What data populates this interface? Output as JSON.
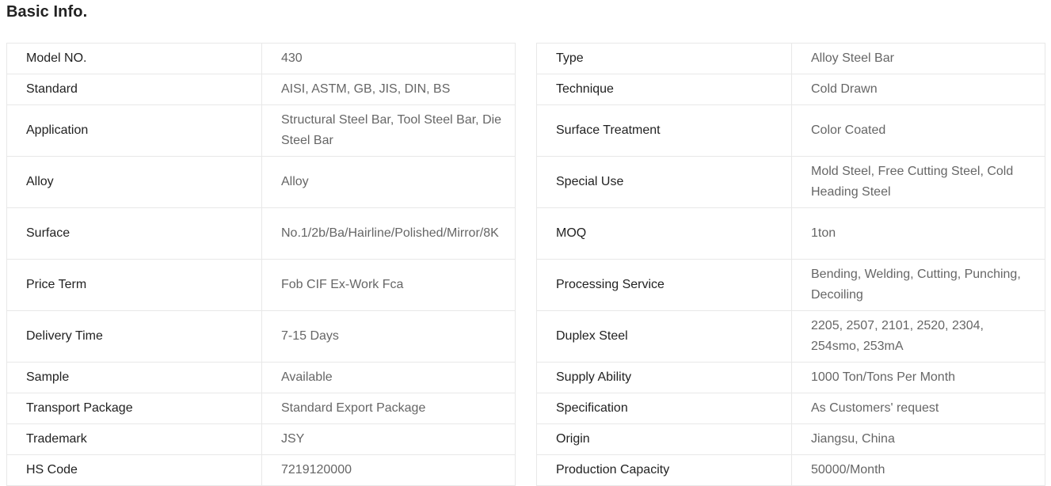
{
  "section": {
    "title": "Basic Info."
  },
  "left_table": [
    {
      "label": "Model NO.",
      "value": "430"
    },
    {
      "label": "Standard",
      "value": "AISI, ASTM, GB, JIS, DIN, BS"
    },
    {
      "label": "Application",
      "value": "Structural Steel Bar, Tool Steel Bar, Die Steel Bar"
    },
    {
      "label": "Alloy",
      "value": "Alloy"
    },
    {
      "label": "Surface",
      "value": "No.1/2b/Ba/Hairline/Polished/Mirror/8K"
    },
    {
      "label": "Price Term",
      "value": "Fob CIF Ex-Work Fca"
    },
    {
      "label": "Delivery Time",
      "value": "7-15 Days"
    },
    {
      "label": "Sample",
      "value": "Available"
    },
    {
      "label": "Transport Package",
      "value": "Standard Export Package"
    },
    {
      "label": "Trademark",
      "value": "JSY"
    },
    {
      "label": "HS Code",
      "value": "7219120000"
    }
  ],
  "right_table": [
    {
      "label": "Type",
      "value": "Alloy Steel Bar"
    },
    {
      "label": "Technique",
      "value": "Cold Drawn"
    },
    {
      "label": "Surface Treatment",
      "value": "Color Coated"
    },
    {
      "label": "Special Use",
      "value": "Mold Steel, Free Cutting Steel, Cold Heading Steel"
    },
    {
      "label": "MOQ",
      "value": "1ton"
    },
    {
      "label": "Processing Service",
      "value": "Bending, Welding, Cutting, Punching, Decoiling"
    },
    {
      "label": "Duplex Steel",
      "value": "2205, 2507, 2101, 2520, 2304, 254smo, 253mA"
    },
    {
      "label": "Supply Ability",
      "value": "1000 Ton/Tons Per Month"
    },
    {
      "label": "Specification",
      "value": "As Customers' request"
    },
    {
      "label": "Origin",
      "value": "Jiangsu, China"
    },
    {
      "label": "Production Capacity",
      "value": "50000/Month"
    }
  ]
}
